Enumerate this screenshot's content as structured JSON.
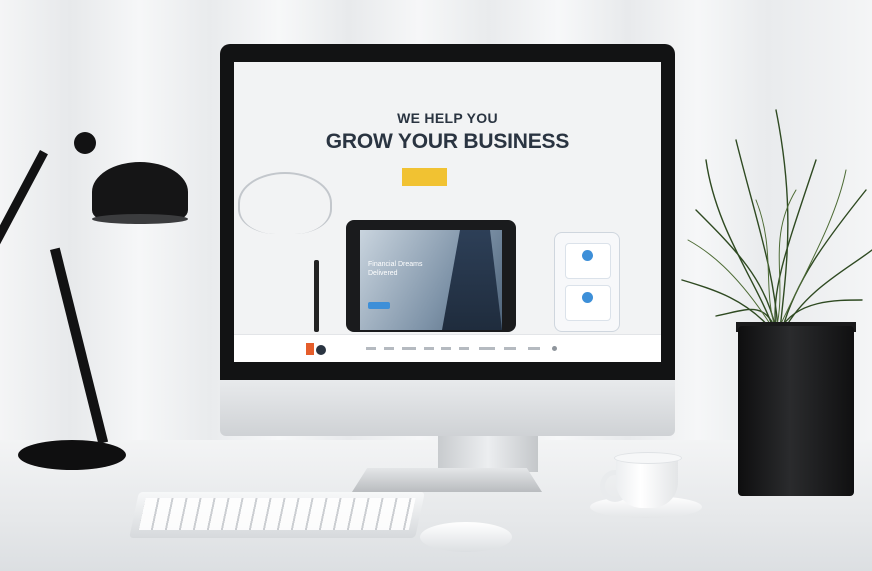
{
  "monitor_screen": {
    "hero": {
      "subtitle": "WE HELP YOU",
      "title": "GROW YOUR BUSINESS"
    },
    "tablet": {
      "headline": "Financial Dreams Delivered"
    }
  }
}
